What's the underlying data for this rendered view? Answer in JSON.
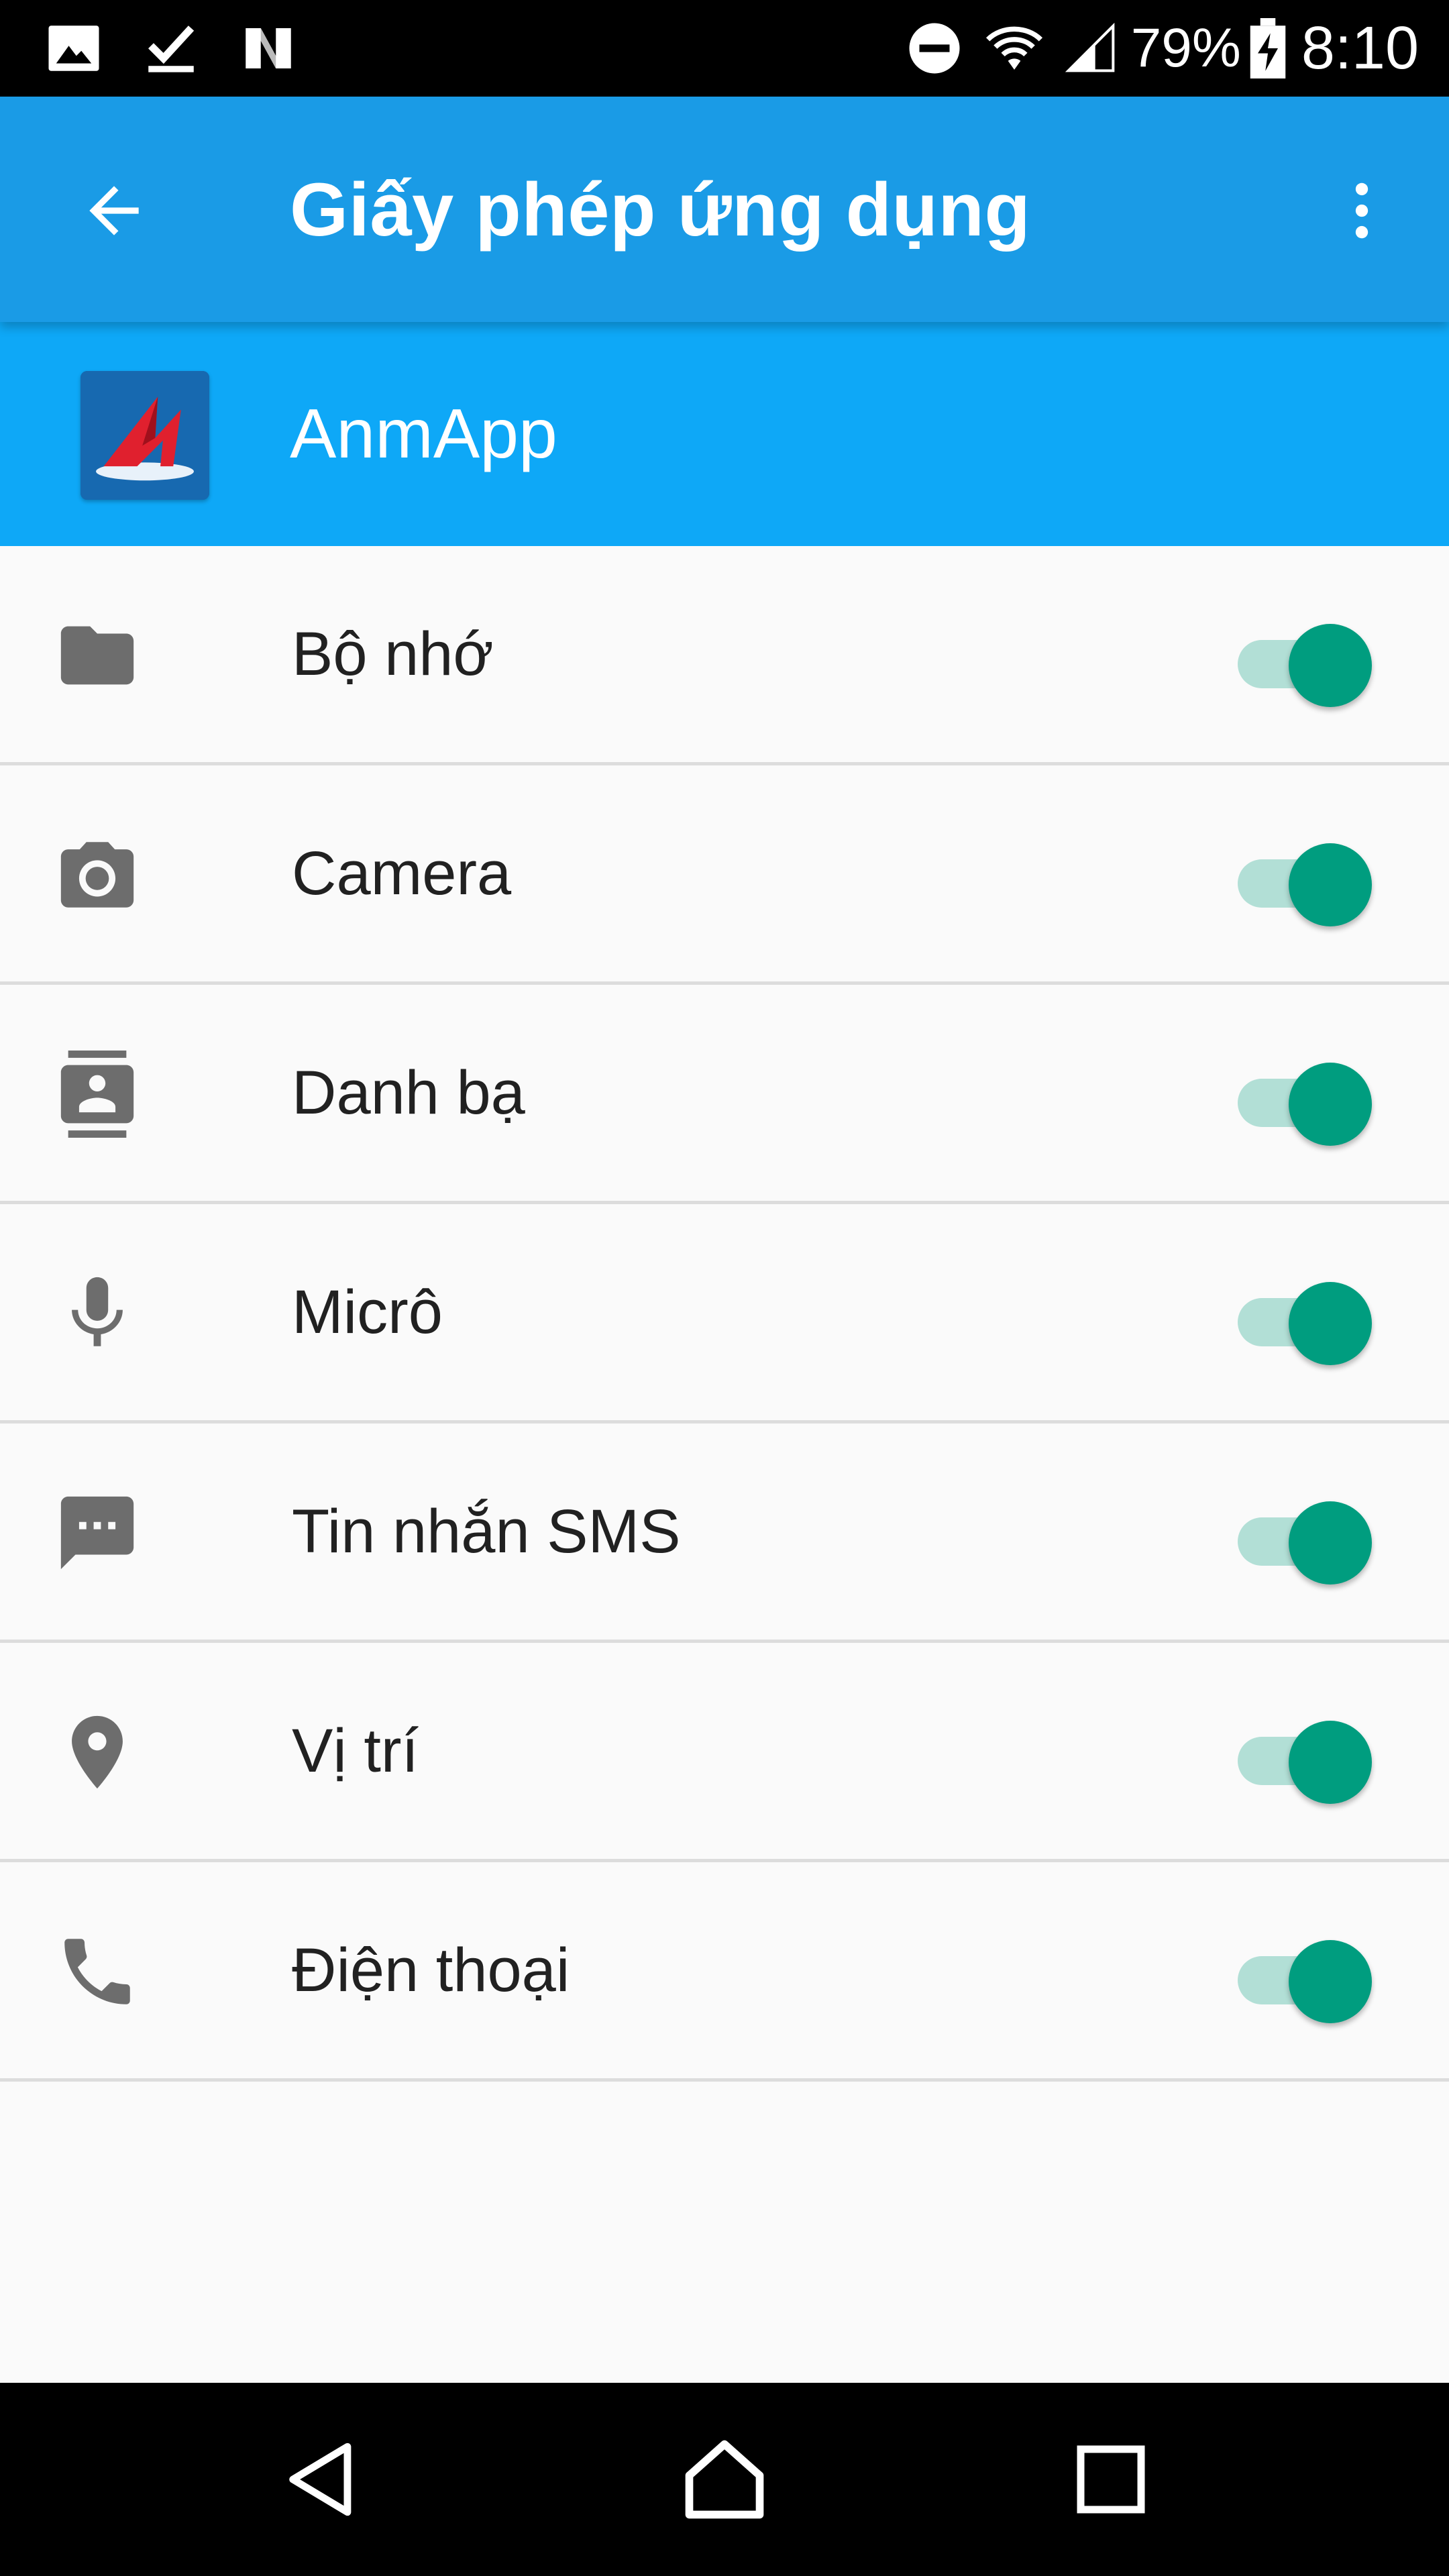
{
  "status_bar": {
    "battery": "79%",
    "time": "8:10",
    "left_icons": [
      "image-icon",
      "download-done-icon",
      "n-icon"
    ],
    "right_icons": [
      "dnd-icon",
      "wifi-icon",
      "signal-icon",
      "battery-charging-icon"
    ]
  },
  "app_bar": {
    "title": "Giấy phép ứng dụng",
    "back_icon": "arrow-back-icon",
    "menu_icon": "more-vert-icon"
  },
  "app_header": {
    "name": "AnmApp"
  },
  "permissions": [
    {
      "label": "Bộ nhớ",
      "icon": "folder-icon",
      "enabled": true
    },
    {
      "label": "Camera",
      "icon": "camera-icon",
      "enabled": true
    },
    {
      "label": "Danh bạ",
      "icon": "contacts-icon",
      "enabled": true
    },
    {
      "label": "Micrô",
      "icon": "mic-icon",
      "enabled": true
    },
    {
      "label": "Tin nhắn SMS",
      "icon": "sms-icon",
      "enabled": true
    },
    {
      "label": "Vị trí",
      "icon": "location-icon",
      "enabled": true
    },
    {
      "label": "Điện thoại",
      "icon": "phone-icon",
      "enabled": true
    }
  ],
  "colors": {
    "app_bar": "#1a9be6",
    "app_header": "#0ea8f7",
    "toggle_thumb": "#009d7f",
    "toggle_track": "#b2dfd6"
  },
  "nav_bar": {
    "icons": [
      "nav-back-icon",
      "nav-home-icon",
      "nav-recents-icon"
    ]
  }
}
